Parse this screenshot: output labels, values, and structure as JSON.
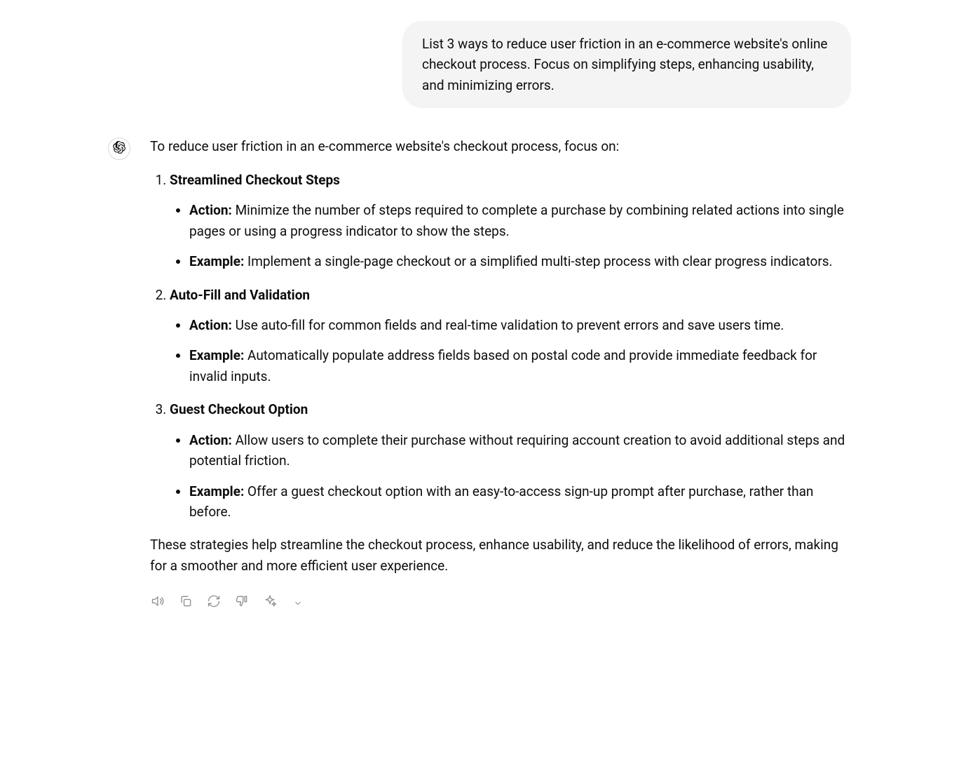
{
  "user_message": "List 3 ways to reduce user friction in an e-commerce website's online checkout process. Focus on simplifying steps, enhancing usability, and minimizing errors.",
  "assistant": {
    "intro": "To reduce user friction in an e-commerce website's checkout process, focus on:",
    "items": [
      {
        "title": "Streamlined Checkout Steps",
        "action_label": "Action:",
        "action_text": " Minimize the number of steps required to complete a purchase by combining related actions into single pages or using a progress indicator to show the steps.",
        "example_label": "Example:",
        "example_text": " Implement a single-page checkout or a simplified multi-step process with clear progress indicators."
      },
      {
        "title": "Auto-Fill and Validation",
        "action_label": "Action:",
        "action_text": " Use auto-fill for common fields and real-time validation to prevent errors and save users time.",
        "example_label": "Example:",
        "example_text": " Automatically populate address fields based on postal code and provide immediate feedback for invalid inputs."
      },
      {
        "title": "Guest Checkout Option",
        "action_label": "Action:",
        "action_text": " Allow users to complete their purchase without requiring account creation to avoid additional steps and potential friction.",
        "example_label": "Example:",
        "example_text": " Offer a guest checkout option with an easy-to-access sign-up prompt after purchase, rather than before."
      }
    ],
    "outro": "These strategies help streamline the checkout process, enhance usability, and reduce the likelihood of errors, making for a smoother and more efficient user experience."
  },
  "action_icons": [
    "speaker",
    "copy",
    "refresh",
    "thumbs-down",
    "sparkle"
  ]
}
